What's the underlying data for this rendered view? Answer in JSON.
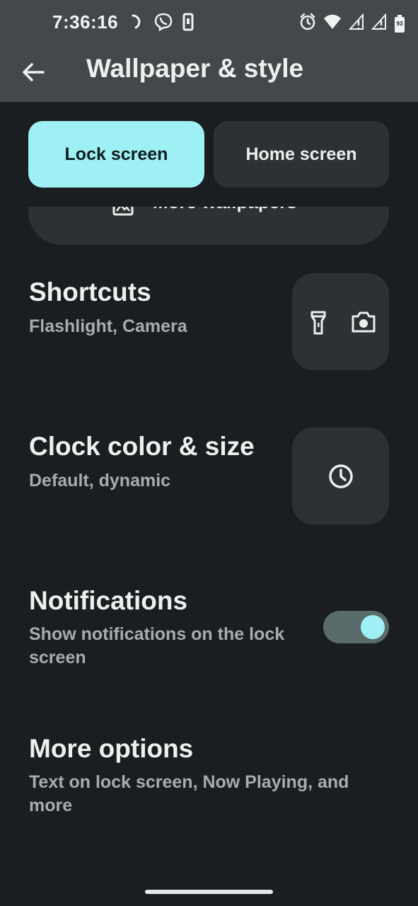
{
  "status_bar": {
    "time": "7:36:16",
    "battery": "93",
    "left_icons": [
      "sync-icon",
      "viber-icon",
      "phone-icon"
    ],
    "right_icons": [
      "alarm-icon",
      "wifi-icon",
      "signal-icon",
      "signal-icon",
      "battery-icon"
    ]
  },
  "app_bar": {
    "title": "Wallpaper & style",
    "back_icon": "arrow-back-icon"
  },
  "tabs": [
    {
      "label": "Lock screen",
      "selected": true
    },
    {
      "label": "Home screen",
      "selected": false
    }
  ],
  "more_wallpapers": {
    "label": "More wallpapers",
    "icon": "wallpaper-icon"
  },
  "settings": {
    "shortcuts": {
      "title": "Shortcuts",
      "subtitle": "Flashlight, Camera",
      "icons": [
        "flashlight-icon",
        "camera-icon"
      ]
    },
    "clock": {
      "title": "Clock color & size",
      "subtitle": "Default, dynamic",
      "icon": "clock-icon"
    },
    "notifications": {
      "title": "Notifications",
      "subtitle": "Show notifications on the lock screen",
      "toggle_on": true
    },
    "more_options": {
      "title": "More options",
      "subtitle": "Text on lock screen, Now Playing, and more"
    }
  },
  "colors": {
    "background": "#1b1e20",
    "app_bar": "#44484a",
    "accent": "#9ff0f5",
    "tile": "#2d3133"
  }
}
